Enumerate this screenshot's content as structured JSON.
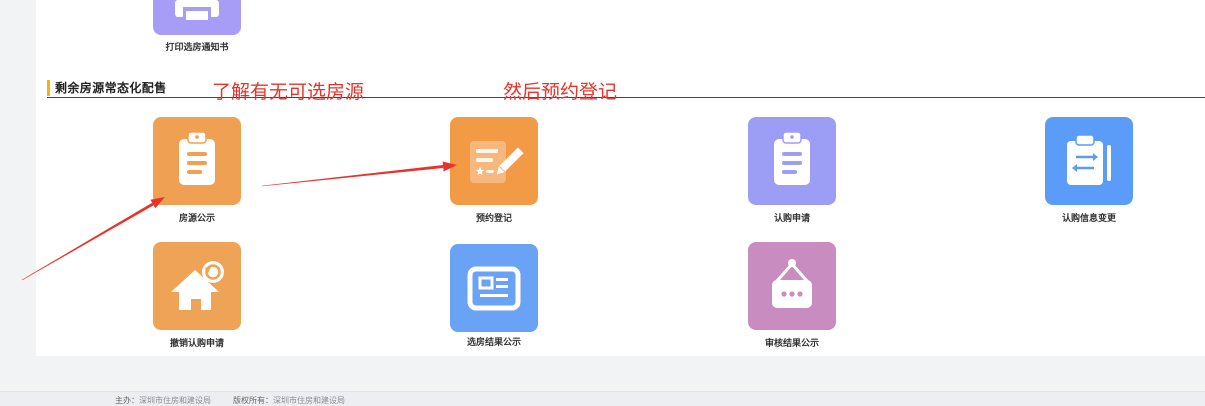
{
  "top_item": {
    "label": "打印选房通知书",
    "icon": "printer-icon",
    "color": "#a79df6"
  },
  "section": {
    "title": "剩余房源常态化配售",
    "accent": "#f5b400"
  },
  "annotations": {
    "note1": "了解有无可选房源",
    "note2": "然后预约登记",
    "color": "#e8332c"
  },
  "tiles": [
    {
      "label": "房源公示",
      "icon": "clipboard-icon",
      "color": "#f0a052"
    },
    {
      "label": "预约登记",
      "icon": "edit-document-icon",
      "color": "#f29a45"
    },
    {
      "label": "认购申请",
      "icon": "clipboard-icon",
      "color": "#9c9ef6"
    },
    {
      "label": "认购信息变更",
      "icon": "clipboard-exchange-icon",
      "color": "#5a9cf8"
    },
    {
      "label": "撤销认购申请",
      "icon": "house-undo-icon",
      "color": "#eea357"
    },
    {
      "label": "选房结果公示",
      "icon": "newspaper-icon",
      "color": "#6aa2f6"
    },
    {
      "label": "审核结果公示",
      "icon": "hanging-sign-icon",
      "color": "#c98cc0"
    }
  ],
  "footer": {
    "host_label": "主办：",
    "host": "深圳市住房和建设局",
    "copyright_label": "版权所有：",
    "copyright": "深圳市住房和建设局"
  }
}
